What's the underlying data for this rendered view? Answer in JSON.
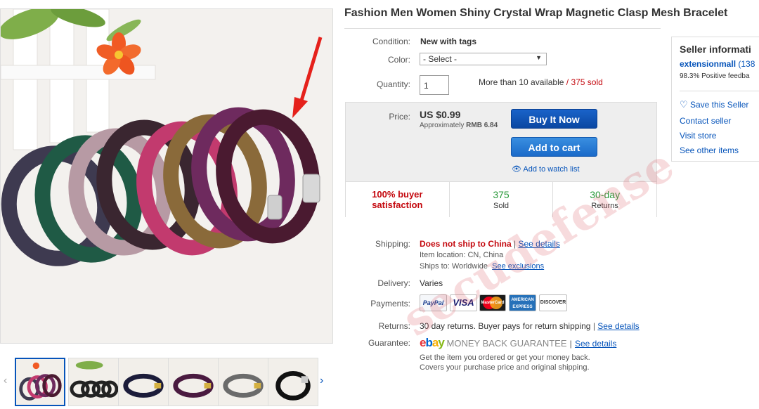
{
  "title": "Fashion Men Women Shiny Crystal Wrap Magnetic Clasp Mesh Bracelet",
  "condition": {
    "label": "Condition:",
    "value": "New with tags"
  },
  "color": {
    "label": "Color:",
    "value": "- Select -"
  },
  "quantity": {
    "label": "Quantity:",
    "value": "1",
    "available": "More than 10 available",
    "slash": "/",
    "sold": "375 sold"
  },
  "price": {
    "label": "Price:",
    "value": "US $0.99",
    "approx": "Approximately",
    "approx_value": "RMB 6.84",
    "buy_now": "Buy It Now",
    "add_cart": "Add to cart",
    "watch": "Add to watch list"
  },
  "stats": [
    {
      "big": "100% buyer",
      "big2": "satisfaction",
      "small": ""
    },
    {
      "big": "375",
      "small": "Sold"
    },
    {
      "big": "30-day",
      "small": "Returns"
    }
  ],
  "shipping": {
    "label": "Shipping:",
    "value": "Does not ship to China",
    "sep": "|",
    "details": "See details",
    "location_label": "Item location:",
    "location": "CN, China",
    "ships_label": "Ships to:",
    "ships": "Worldwide",
    "exclusions": "See exclusions"
  },
  "delivery": {
    "label": "Delivery:",
    "value": "Varies"
  },
  "payments": {
    "label": "Payments:",
    "cards": [
      "PayPal",
      "VISA",
      "MasterCard",
      "AMERICAN EXPRESS",
      "DISCOVER"
    ]
  },
  "returns": {
    "label": "Returns:",
    "value": "30 day returns. Buyer pays for return shipping",
    "sep": "|",
    "details": "See details"
  },
  "guarantee": {
    "label": "Guarantee:",
    "brand": [
      "e",
      "b",
      "a",
      "y"
    ],
    "text": "MONEY BACK GUARANTEE",
    "sep": "|",
    "details": "See details",
    "line1": "Get the item you ordered or get your money back.",
    "line2": "Covers your purchase price and original shipping."
  },
  "seller": {
    "title": "Seller informati",
    "name": "extensionmall",
    "score": "(138",
    "positive": "98.3% Positive feedba",
    "save": "Save this Seller",
    "contact": "Contact seller",
    "visit": "Visit store",
    "other": "See other items"
  },
  "watermark": "secudefense",
  "colors": {
    "link": "#0654ba",
    "red": "#c4080e",
    "green": "#2b9a3b"
  }
}
